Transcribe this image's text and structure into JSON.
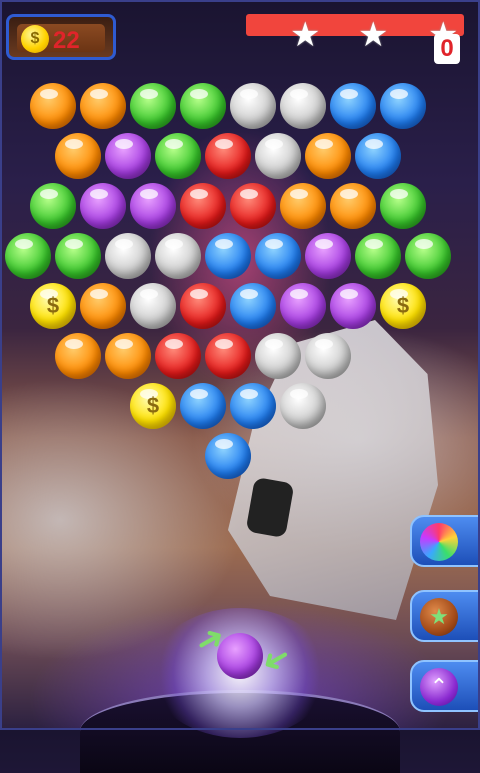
{
  "hud": {
    "coins": "22",
    "coin_symbol": "$",
    "score": "0",
    "stars": [
      "★",
      "★",
      "★"
    ]
  },
  "grid": {
    "rows": [
      [
        "orange",
        "orange",
        "green",
        "green",
        "gray",
        "gray",
        "blue",
        "blue"
      ],
      [
        "orange",
        "purple",
        "green",
        "red",
        "gray",
        "orange",
        "blue"
      ],
      [
        "green",
        "purple",
        "purple",
        "red",
        "red",
        "orange",
        "orange",
        "green"
      ],
      [
        "green",
        "green",
        "gray",
        "gray",
        "blue",
        "blue",
        "purple",
        "green",
        "green"
      ],
      [
        "coin",
        "orange",
        "gray",
        "red",
        "blue",
        "purple",
        "purple",
        "coin"
      ],
      [
        "orange",
        "orange",
        "red",
        "red",
        "gray",
        "gray"
      ],
      [
        "coin",
        "blue",
        "blue",
        "gray"
      ],
      [
        "blue"
      ]
    ],
    "coin_symbol": "$"
  },
  "shooter": {
    "color": "purple"
  },
  "powerups": [
    {
      "name": "rainbow-ball",
      "glyph": ""
    },
    {
      "name": "bomb",
      "glyph": "★"
    },
    {
      "name": "aim-up",
      "glyph": "⌃"
    }
  ],
  "colors": {
    "orange": "#ff8a00",
    "green": "#37c52a",
    "gray": "#c9c9c9",
    "blue": "#1f7cf0",
    "purple": "#a43be0",
    "red": "#e51a1a",
    "coin": "#ffe200"
  }
}
